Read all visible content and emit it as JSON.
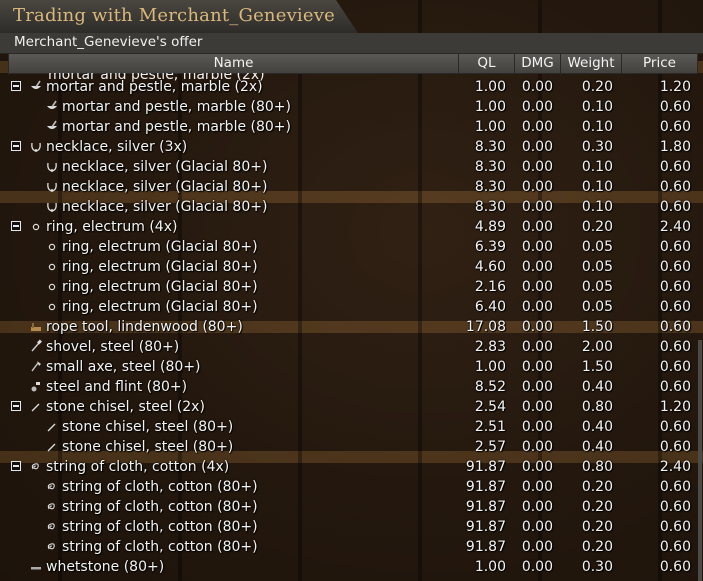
{
  "window": {
    "title": "Trading with Merchant_Genevieve",
    "subtitle": "Merchant_Genevieve's offer"
  },
  "columns": [
    "Name",
    "QL",
    "DMG",
    "Weight",
    "Price"
  ],
  "partial_row_text": "mortar and pestle, marble (2x)",
  "rows": [
    {
      "level": 0,
      "toggle": true,
      "icon": "mortar-pestle-icon",
      "name": "mortar and pestle, marble (2x)",
      "ql": "1.00",
      "dmg": "0.00",
      "weight": "0.20",
      "price": "1.20"
    },
    {
      "level": 1,
      "toggle": false,
      "icon": "mortar-pestle-icon",
      "name": "mortar and pestle, marble (80+)",
      "ql": "1.00",
      "dmg": "0.00",
      "weight": "0.10",
      "price": "0.60"
    },
    {
      "level": 1,
      "toggle": false,
      "icon": "mortar-pestle-icon",
      "name": "mortar and pestle, marble (80+)",
      "ql": "1.00",
      "dmg": "0.00",
      "weight": "0.10",
      "price": "0.60"
    },
    {
      "level": 0,
      "toggle": true,
      "icon": "necklace-icon",
      "name": "necklace, silver (3x)",
      "ql": "8.30",
      "dmg": "0.00",
      "weight": "0.30",
      "price": "1.80"
    },
    {
      "level": 1,
      "toggle": false,
      "icon": "necklace-icon",
      "name": "necklace, silver (Glacial 80+)",
      "ql": "8.30",
      "dmg": "0.00",
      "weight": "0.10",
      "price": "0.60"
    },
    {
      "level": 1,
      "toggle": false,
      "icon": "necklace-icon",
      "name": "necklace, silver (Glacial 80+)",
      "ql": "8.30",
      "dmg": "0.00",
      "weight": "0.10",
      "price": "0.60"
    },
    {
      "level": 1,
      "toggle": false,
      "icon": "necklace-icon",
      "name": "necklace, silver (Glacial 80+)",
      "ql": "8.30",
      "dmg": "0.00",
      "weight": "0.10",
      "price": "0.60"
    },
    {
      "level": 0,
      "toggle": true,
      "icon": "ring-icon",
      "name": "ring, electrum (4x)",
      "ql": "4.89",
      "dmg": "0.00",
      "weight": "0.20",
      "price": "2.40"
    },
    {
      "level": 1,
      "toggle": false,
      "icon": "ring-icon",
      "name": "ring, electrum (Glacial 80+)",
      "ql": "6.39",
      "dmg": "0.00",
      "weight": "0.05",
      "price": "0.60"
    },
    {
      "level": 1,
      "toggle": false,
      "icon": "ring-icon",
      "name": "ring, electrum (Glacial 80+)",
      "ql": "4.60",
      "dmg": "0.00",
      "weight": "0.05",
      "price": "0.60"
    },
    {
      "level": 1,
      "toggle": false,
      "icon": "ring-icon",
      "name": "ring, electrum (Glacial 80+)",
      "ql": "2.16",
      "dmg": "0.00",
      "weight": "0.05",
      "price": "0.60"
    },
    {
      "level": 1,
      "toggle": false,
      "icon": "ring-icon",
      "name": "ring, electrum (Glacial 80+)",
      "ql": "6.40",
      "dmg": "0.00",
      "weight": "0.05",
      "price": "0.60"
    },
    {
      "level": 0,
      "toggle": false,
      "icon": "rope-tool-icon",
      "name": "rope tool, lindenwood (80+)",
      "ql": "17.08",
      "dmg": "0.00",
      "weight": "1.50",
      "price": "0.60"
    },
    {
      "level": 0,
      "toggle": false,
      "icon": "shovel-icon",
      "name": "shovel, steel (80+)",
      "ql": "2.83",
      "dmg": "0.00",
      "weight": "2.00",
      "price": "0.60"
    },
    {
      "level": 0,
      "toggle": false,
      "icon": "axe-icon",
      "name": "small axe, steel (80+)",
      "ql": "1.00",
      "dmg": "0.00",
      "weight": "1.50",
      "price": "0.60"
    },
    {
      "level": 0,
      "toggle": false,
      "icon": "steel-flint-icon",
      "name": "steel and flint (80+)",
      "ql": "8.52",
      "dmg": "0.00",
      "weight": "0.40",
      "price": "0.60"
    },
    {
      "level": 0,
      "toggle": true,
      "icon": "chisel-icon",
      "name": "stone chisel, steel (2x)",
      "ql": "2.54",
      "dmg": "0.00",
      "weight": "0.80",
      "price": "1.20"
    },
    {
      "level": 1,
      "toggle": false,
      "icon": "chisel-icon",
      "name": "stone chisel, steel (80+)",
      "ql": "2.51",
      "dmg": "0.00",
      "weight": "0.40",
      "price": "0.60"
    },
    {
      "level": 1,
      "toggle": false,
      "icon": "chisel-icon",
      "name": "stone chisel, steel (80+)",
      "ql": "2.57",
      "dmg": "0.00",
      "weight": "0.40",
      "price": "0.60"
    },
    {
      "level": 0,
      "toggle": true,
      "icon": "string-cloth-icon",
      "name": "string of cloth, cotton (4x)",
      "ql": "91.87",
      "dmg": "0.00",
      "weight": "0.80",
      "price": "2.40"
    },
    {
      "level": 1,
      "toggle": false,
      "icon": "string-cloth-icon",
      "name": "string of cloth, cotton (80+)",
      "ql": "91.87",
      "dmg": "0.00",
      "weight": "0.20",
      "price": "0.60"
    },
    {
      "level": 1,
      "toggle": false,
      "icon": "string-cloth-icon",
      "name": "string of cloth, cotton (80+)",
      "ql": "91.87",
      "dmg": "0.00",
      "weight": "0.20",
      "price": "0.60"
    },
    {
      "level": 1,
      "toggle": false,
      "icon": "string-cloth-icon",
      "name": "string of cloth, cotton (80+)",
      "ql": "91.87",
      "dmg": "0.00",
      "weight": "0.20",
      "price": "0.60"
    },
    {
      "level": 1,
      "toggle": false,
      "icon": "string-cloth-icon",
      "name": "string of cloth, cotton (80+)",
      "ql": "91.87",
      "dmg": "0.00",
      "weight": "0.20",
      "price": "0.60"
    },
    {
      "level": 0,
      "toggle": false,
      "icon": "whetstone-icon",
      "name": "whetstone (80+)",
      "ql": "1.00",
      "dmg": "0.00",
      "weight": "0.30",
      "price": "0.60"
    }
  ]
}
